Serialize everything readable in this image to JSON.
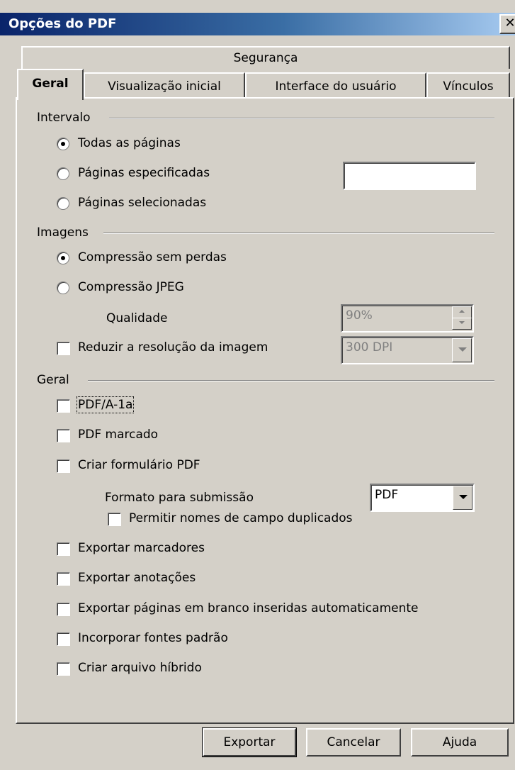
{
  "window": {
    "title": "Opções do PDF",
    "close_glyph": "✕"
  },
  "tabs": {
    "row1": [
      {
        "label": "Segurança"
      }
    ],
    "row2": [
      {
        "label": "Geral",
        "active": true
      },
      {
        "label": "Visualização inicial"
      },
      {
        "label": "Interface do usuário"
      },
      {
        "label": "Vínculos"
      }
    ]
  },
  "intervalo": {
    "title": "Intervalo",
    "all_pages": {
      "label": "Todas as páginas",
      "checked": true
    },
    "specified": {
      "label": "Páginas especificadas",
      "value": ""
    },
    "selected": {
      "label": "Páginas selecionadas"
    }
  },
  "imagens": {
    "title": "Imagens",
    "lossless": {
      "label": "Compressão sem perdas",
      "checked": true
    },
    "jpeg": {
      "label": "Compressão JPEG"
    },
    "quality": {
      "label": "Qualidade",
      "value": "90%"
    },
    "reduce": {
      "label": "Reduzir a resolução da imagem",
      "value": "300 DPI"
    }
  },
  "geral": {
    "title": "Geral",
    "pdfa": {
      "label": "PDF/A-1a"
    },
    "tagged": {
      "label": "PDF marcado"
    },
    "form": {
      "label": "Criar formulário PDF"
    },
    "submit_format": {
      "label": "Formato para submissão",
      "value": "PDF"
    },
    "allow_dup": {
      "label": "Permitir nomes de campo duplicados"
    },
    "bookmarks": {
      "label": "Exportar marcadores"
    },
    "notes": {
      "label": "Exportar anotações"
    },
    "blank_pages": {
      "label": "Exportar páginas em branco inseridas automaticamente"
    },
    "embed_fonts": {
      "label": "Incorporar fontes padrão"
    },
    "hybrid": {
      "label": "Criar arquivo híbrido"
    }
  },
  "buttons": {
    "export": "Exportar",
    "cancel": "Cancelar",
    "help": "Ajuda"
  }
}
